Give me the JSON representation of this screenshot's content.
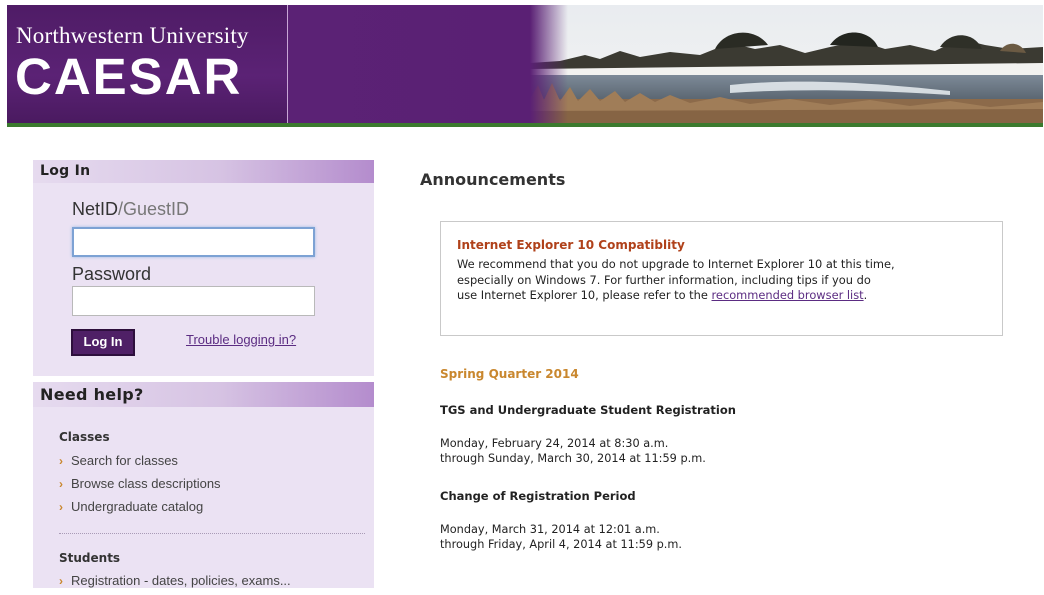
{
  "header": {
    "university": "Northwestern University",
    "system": "CAESAR"
  },
  "login": {
    "heading": "Log In",
    "netid_label": "NetID",
    "netid_slash": "/",
    "guestid_label": "GuestID",
    "netid_value": "",
    "password_label": "Password",
    "password_value": "",
    "submit_label": "Log In",
    "trouble_link": "Trouble logging in?"
  },
  "help": {
    "heading": "Need help?",
    "groups": [
      {
        "title": "Classes",
        "items": [
          "Search for classes",
          "Browse class descriptions",
          "Undergraduate catalog"
        ]
      },
      {
        "title": "Students",
        "items": [
          "Registration - dates, policies, exams..."
        ]
      }
    ]
  },
  "announcements": {
    "heading": "Announcements",
    "notice": {
      "title": "Internet Explorer 10 Compatiblity",
      "body_line1": "We recommend that you do not upgrade to Internet Explorer 10 at this time,",
      "body_line2": "especially on Windows 7. For further information, including tips if you do",
      "body_line3_pre": "use Internet Explorer 10, please refer to the ",
      "body_link": "recommended browser list",
      "body_line3_post": "."
    },
    "quarter": "Spring Quarter 2014",
    "sections": [
      {
        "title": "TGS and Undergraduate Student Registration",
        "line1": "Monday, February 24, 2014 at 8:30 a.m.",
        "line2": "through Sunday, March 30, 2014 at 11:59 p.m."
      },
      {
        "title": "Change of Registration Period",
        "line1": "Monday, March 31, 2014 at 12:01 a.m.",
        "line2": "through Friday, April 4, 2014 at 11:59 p.m."
      }
    ]
  },
  "icons": {
    "list_bullet": "chevron-right-icon"
  },
  "colors": {
    "brand_purple": "#4e2a84",
    "header_purple": "#5d2377",
    "accent_green": "#3b7a2e",
    "panel_lavender": "#ebe2f3",
    "notice_title": "#b0411a",
    "quarter_orange": "#c9872e",
    "link_purple": "#5b2c82"
  }
}
